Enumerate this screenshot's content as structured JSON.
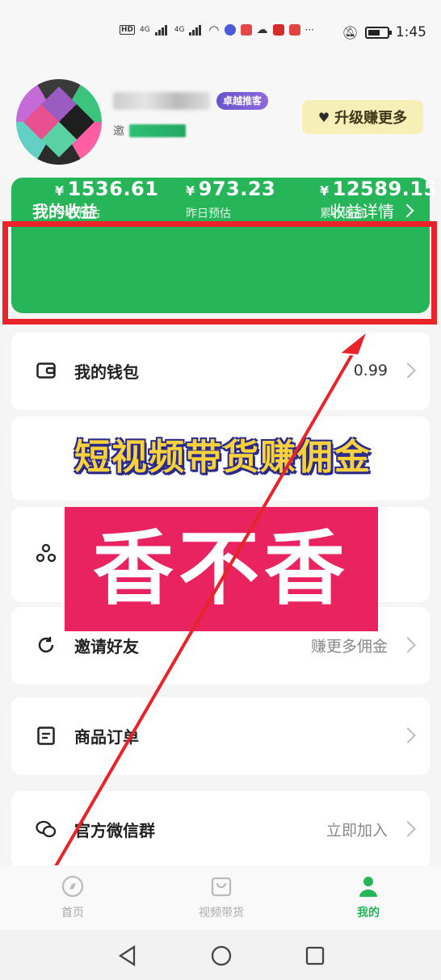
{
  "status_bar": {
    "time": "1:45",
    "net1": "4G",
    "net2": "4G",
    "more": "···"
  },
  "profile": {
    "vip_badge": "卓越推客",
    "id_prefix": "邀",
    "upgrade_label": "升级赚更多"
  },
  "earnings": {
    "title": "我的收益",
    "detail_label": "收益详情",
    "stats": [
      {
        "currency": "¥",
        "value": "1536.61",
        "label": "今日预估"
      },
      {
        "currency": "¥",
        "value": "973.23",
        "label": "昨日预估"
      },
      {
        "currency": "¥",
        "value": "12589.15",
        "label": "累计收益"
      }
    ]
  },
  "menu": {
    "wallet": {
      "label": "我的钱包",
      "value": "0.99"
    },
    "invite": {
      "label": "邀请好友",
      "value": "赚更多佣金"
    },
    "orders": {
      "label": "商品订单",
      "value": ""
    },
    "wechat_group": {
      "label": "官方微信群",
      "value": "立即加入"
    }
  },
  "overlay": {
    "headline": "短视频带货赚佣金",
    "big_text": "香不香"
  },
  "tabs": [
    {
      "label": "首页"
    },
    {
      "label": "视频带货"
    },
    {
      "label": "我的"
    }
  ],
  "colors": {
    "accent_green": "#27b55a",
    "frame_red": "#e8232a",
    "promo_pink": "#e8235f",
    "headline_yellow": "#f7d23d"
  }
}
